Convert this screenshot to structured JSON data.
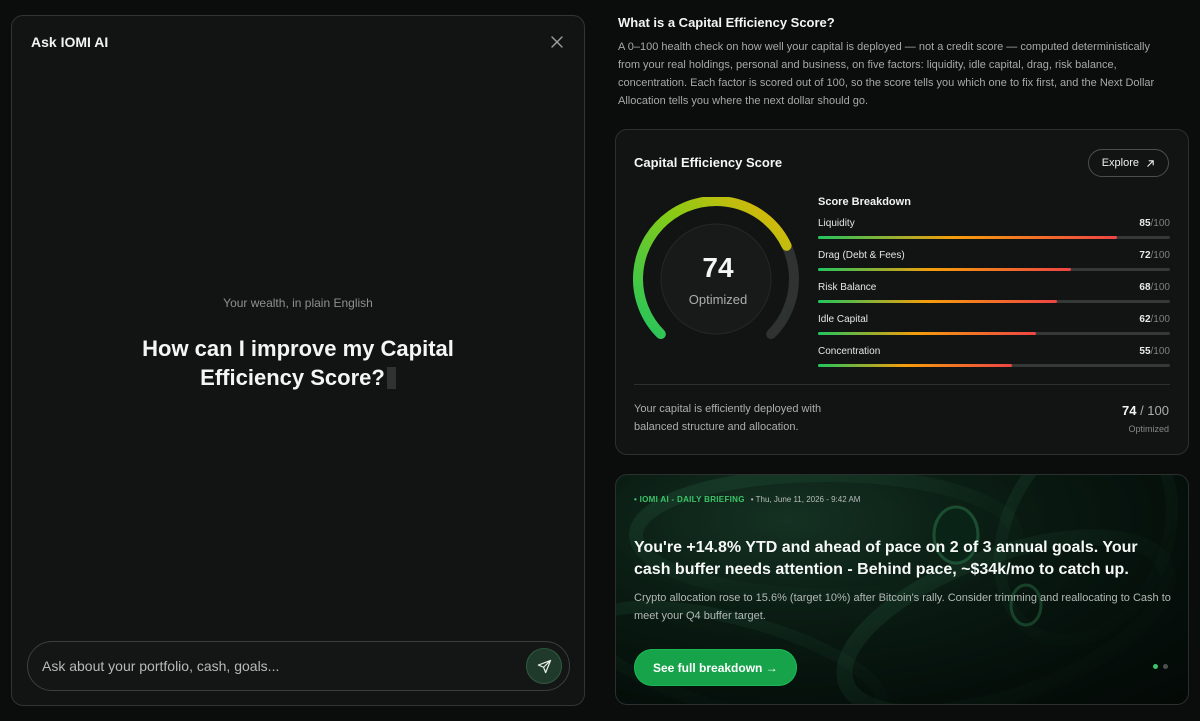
{
  "chat": {
    "title": "Ask IOMI AI",
    "eyebrow": "Your wealth, in plain English",
    "question": "How can I improve my Capital Efficiency Score?",
    "input_placeholder": "Ask about your portfolio, cash, goals..."
  },
  "info": {
    "title": "What is a Capital Efficiency Score?",
    "body": "A 0–100 health check on how well your capital is deployed — not a credit score — computed deterministically from your real holdings, personal and business, on five factors: liquidity, idle capital, drag, risk balance, concentration. Each factor is scored out of 100, so the score tells you which one to fix first, and the Next Dollar Allocation tells you where the next dollar should go."
  },
  "score_card": {
    "title": "Capital Efficiency Score",
    "explore_label": "Explore",
    "gauge_value": "74",
    "gauge_fraction": 0.74,
    "gauge_label": "Optimized",
    "breakdown_title": "Score Breakdown",
    "metrics": [
      {
        "label": "Liquidity",
        "score": "85",
        "max": "/100",
        "value": 85
      },
      {
        "label": "Drag (Debt & Fees)",
        "score": "72",
        "max": "/100",
        "value": 72
      },
      {
        "label": "Risk Balance",
        "score": "68",
        "max": "/100",
        "value": 68
      },
      {
        "label": "Idle Capital",
        "score": "62",
        "max": "/100",
        "value": 62
      },
      {
        "label": "Concentration",
        "score": "55",
        "max": "/100",
        "value": 55
      }
    ],
    "summary": "Your capital is efficiently deployed with balanced structure and allocation.",
    "summary_score": "74",
    "summary_max": " / 100",
    "summary_label": "Optimized"
  },
  "briefing": {
    "tag": "• IOMI AI - DAILY BRIEFING",
    "date": "• Thu, June 11, 2026 - 9:42 AM",
    "headline": "You're +14.8% YTD and ahead of pace on 2 of 3 annual goals. Your cash buffer needs attention - Behind pace, ~$34k/mo to catch up.",
    "text": "Crypto allocation rose to 15.6% (target 10%) after Bitcoin's rally. Consider trimming and reallocating to Cash to meet your Q4 buffer target.",
    "button_label": "See full breakdown →"
  },
  "colors": {
    "accent_green": "#16a34a",
    "bar_start": "#22c55e",
    "bar_mid": "#f59e0b",
    "bar_end": "#ef4444"
  }
}
